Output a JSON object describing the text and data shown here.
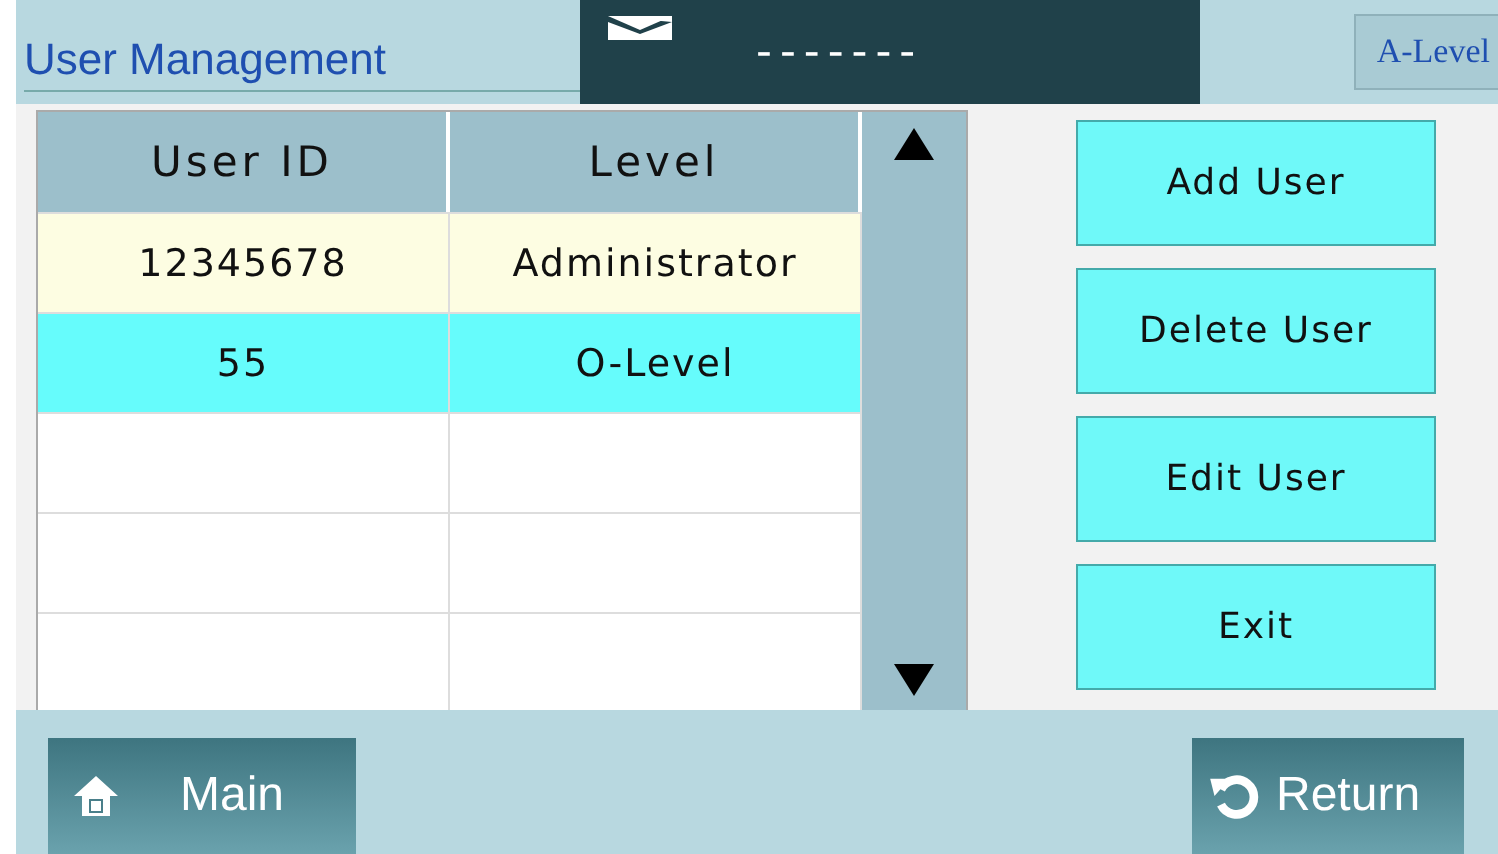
{
  "header": {
    "title": "User Management",
    "message": "-------",
    "level_badge": "A-Level"
  },
  "table": {
    "columns": [
      "User ID",
      "Level"
    ],
    "rows": [
      {
        "cells": [
          "12345678",
          "Administrator"
        ],
        "selected": false
      },
      {
        "cells": [
          "55",
          "O-Level"
        ],
        "selected": true
      }
    ]
  },
  "actions": [
    "Add User",
    "Delete User",
    "Edit User",
    "Exit"
  ],
  "footer": {
    "main": "Main",
    "return": "Return"
  }
}
